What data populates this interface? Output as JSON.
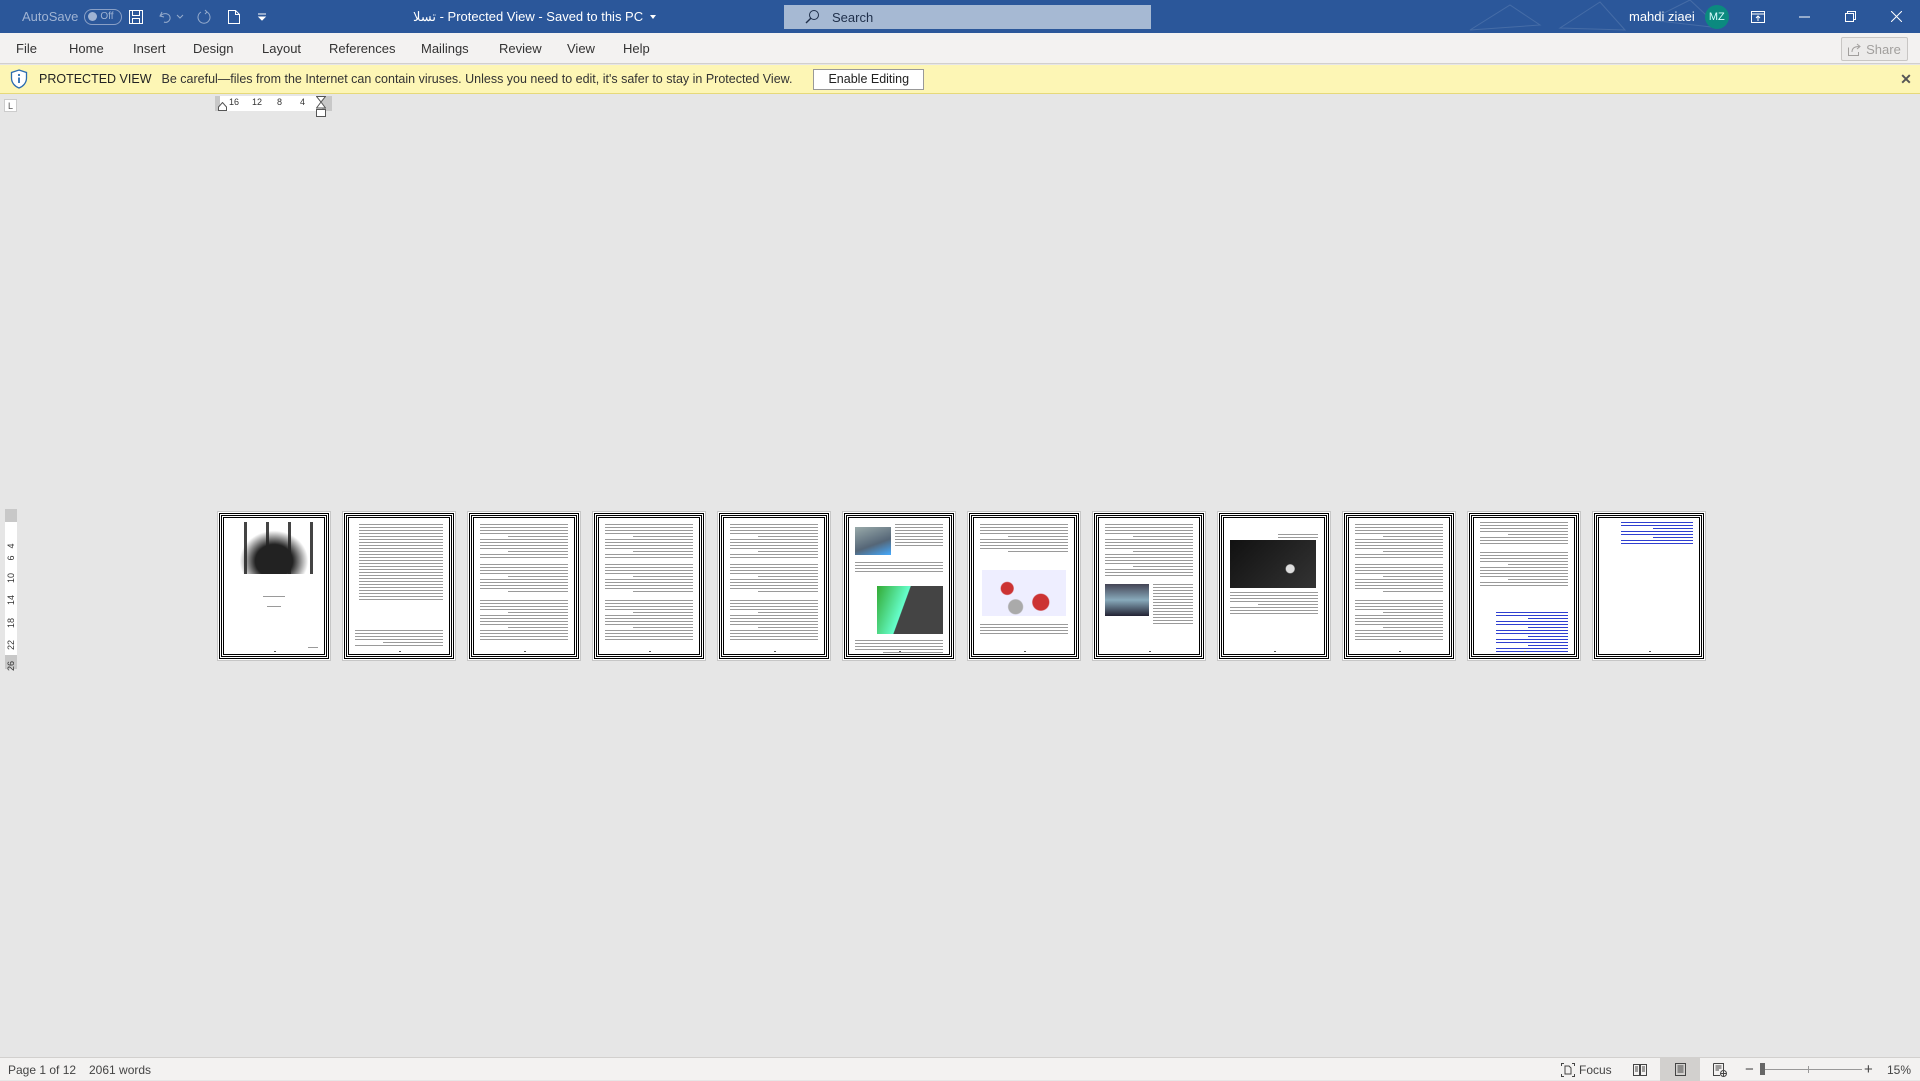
{
  "titlebar": {
    "autosave_label": "AutoSave",
    "autosave_state": "Off",
    "doc_title": "تسلا  -  Protected View  -  Saved to this PC",
    "search_placeholder": "Search",
    "user_name": "mahdi ziaei",
    "user_initials": "MZ",
    "icons": [
      "save-icon",
      "undo-icon",
      "redo-icon",
      "new-doc-icon",
      "customize-qat-icon"
    ],
    "window_controls": [
      "ribbon-display-options",
      "minimize",
      "restore",
      "close"
    ]
  },
  "ribbon": {
    "tabs": [
      "File",
      "Home",
      "Insert",
      "Design",
      "Layout",
      "References",
      "Mailings",
      "Review",
      "View",
      "Help"
    ],
    "share_label": "Share"
  },
  "protected_view": {
    "label": "PROTECTED VIEW",
    "message": "Be careful—files from the Internet can contain viruses. Unless you need to edit, it's safer to stay in Protected View.",
    "enable_button": "Enable Editing"
  },
  "rulers": {
    "tab_selector": "L",
    "horizontal_ticks": [
      "16",
      "12",
      "8",
      "4"
    ],
    "vertical_ticks": [
      "4",
      "6",
      "10",
      "14",
      "18",
      "22",
      "26"
    ]
  },
  "document": {
    "page_count": 12,
    "pages": [
      {
        "number": 1,
        "kind": "cover"
      },
      {
        "number": 2,
        "kind": "toc"
      },
      {
        "number": 3,
        "kind": "text"
      },
      {
        "number": 4,
        "kind": "text"
      },
      {
        "number": 5,
        "kind": "text"
      },
      {
        "number": 6,
        "kind": "text-images"
      },
      {
        "number": 7,
        "kind": "text-image"
      },
      {
        "number": 8,
        "kind": "text-image"
      },
      {
        "number": 9,
        "kind": "image-text"
      },
      {
        "number": 10,
        "kind": "text"
      },
      {
        "number": 11,
        "kind": "text-links"
      },
      {
        "number": 12,
        "kind": "links"
      }
    ]
  },
  "statusbar": {
    "page_info": "Page 1 of 12",
    "word_count": "2061 words",
    "focus_label": "Focus",
    "zoom_minus": "−",
    "zoom_plus": "+",
    "zoom_level": "15%",
    "zoom_percent": 15,
    "active_view": "print-layout"
  },
  "colors": {
    "titlebar": "#2b579a",
    "protected_bar": "#fdf6b5",
    "avatar": "#0b8a7f",
    "link": "#2f3fd0"
  }
}
